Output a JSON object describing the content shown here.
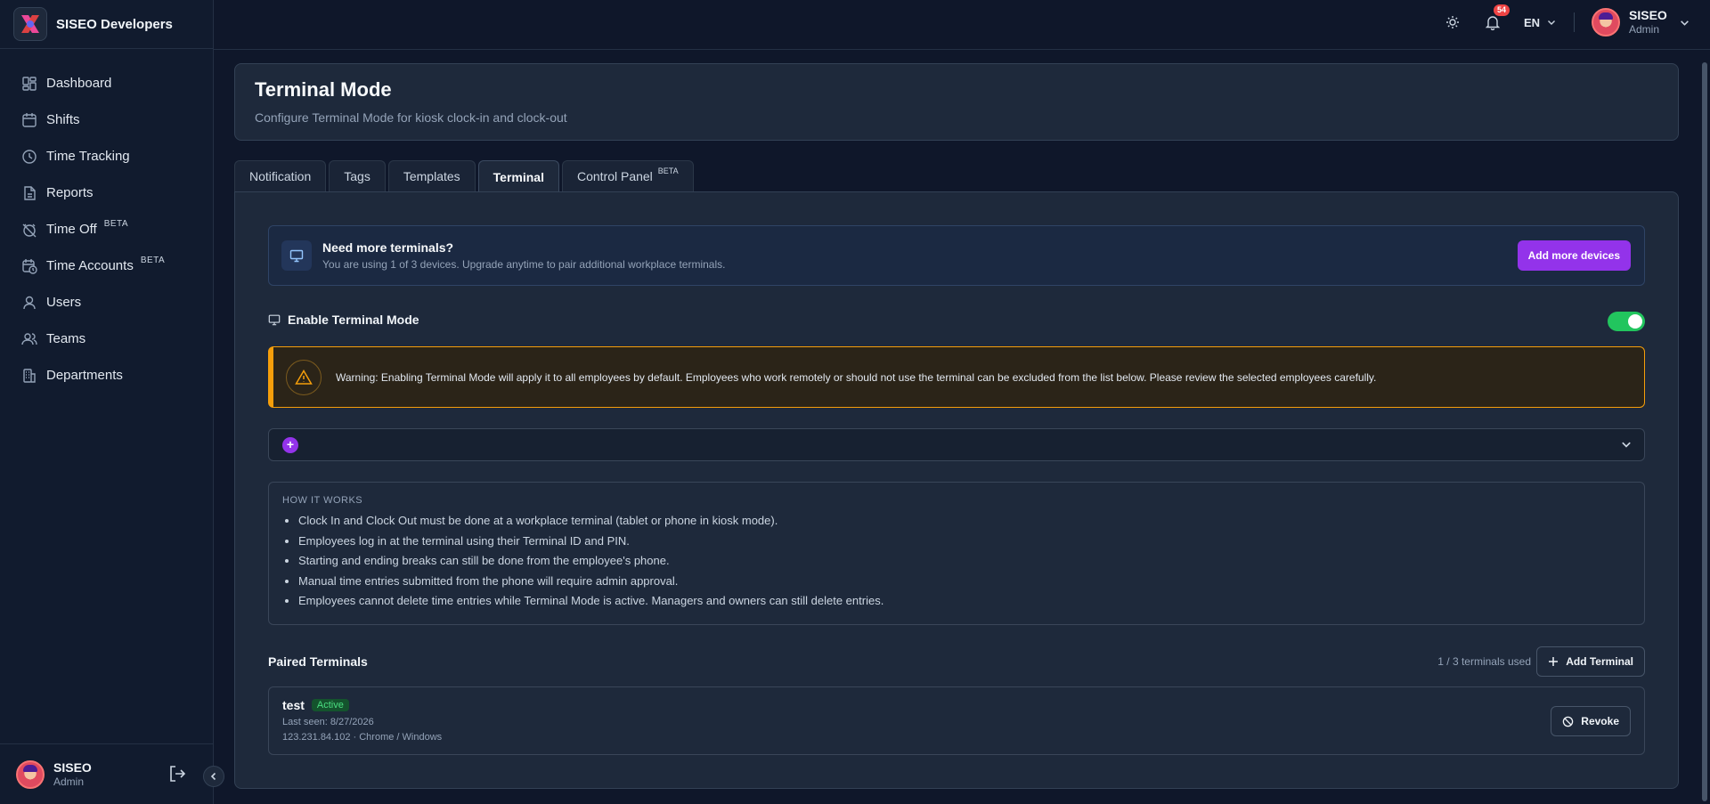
{
  "brand": {
    "name": "SISEO Developers"
  },
  "sidebar": {
    "items": [
      {
        "label": "Dashboard",
        "icon": "dashboard-icon",
        "badge": ""
      },
      {
        "label": "Shifts",
        "icon": "calendar-icon",
        "badge": ""
      },
      {
        "label": "Time Tracking",
        "icon": "clock-icon",
        "badge": ""
      },
      {
        "label": "Reports",
        "icon": "file-icon",
        "badge": ""
      },
      {
        "label": "Time Off",
        "icon": "alarm-off-icon",
        "badge": "BETA"
      },
      {
        "label": "Time Accounts",
        "icon": "calendar-clock-icon",
        "badge": "BETA"
      },
      {
        "label": "Users",
        "icon": "user-icon",
        "badge": ""
      },
      {
        "label": "Teams",
        "icon": "users-icon",
        "badge": ""
      },
      {
        "label": "Departments",
        "icon": "building-icon",
        "badge": ""
      }
    ],
    "footer": {
      "name": "SISEO",
      "role": "Admin"
    }
  },
  "topbar": {
    "notification_count": "54",
    "language": "EN",
    "user": {
      "name": "SISEO",
      "role": "Admin"
    }
  },
  "page": {
    "title": "Terminal Mode",
    "subtitle": "Configure Terminal Mode for kiosk clock-in and clock-out"
  },
  "tabs": [
    {
      "label": "Notification",
      "badge": ""
    },
    {
      "label": "Tags",
      "badge": ""
    },
    {
      "label": "Templates",
      "badge": ""
    },
    {
      "label": "Terminal",
      "badge": ""
    },
    {
      "label": "Control Panel",
      "badge": "BETA"
    }
  ],
  "active_tab": "Terminal",
  "upsell": {
    "title": "Need more terminals?",
    "description": "You are using 1 of 3 devices. Upgrade anytime to pair additional workplace terminals.",
    "button": "Add more devices"
  },
  "enable": {
    "label": "Enable Terminal Mode",
    "enabled": true
  },
  "warning": {
    "text": "Warning: Enabling Terminal Mode will apply it to all employees by default. Employees who work remotely or should not use the terminal can be excluded from the list below. Please review the selected employees carefully."
  },
  "how_it_works": {
    "title": "HOW IT WORKS",
    "items": [
      "Clock In and Clock Out must be done at a workplace terminal (tablet or phone in kiosk mode).",
      "Employees log in at the terminal using their Terminal ID and PIN.",
      "Starting and ending breaks can still be done from the employee's phone.",
      "Manual time entries submitted from the phone will require admin approval.",
      "Employees cannot delete time entries while Terminal Mode is active. Managers and owners can still delete entries."
    ]
  },
  "paired": {
    "title": "Paired Terminals",
    "count": "1 / 3 terminals used",
    "add_button": "Add Terminal",
    "terminals": [
      {
        "name": "test",
        "status": "Active",
        "last_seen": "Last seen: 8/27/2026",
        "details": "123.231.84.102 · Chrome / Windows",
        "revoke_label": "Revoke"
      }
    ]
  },
  "colors": {
    "accent_purple": "#9333ea",
    "toggle_green": "#22c55e",
    "warning_amber": "#f59e0b",
    "notification_red": "#ef4444"
  }
}
